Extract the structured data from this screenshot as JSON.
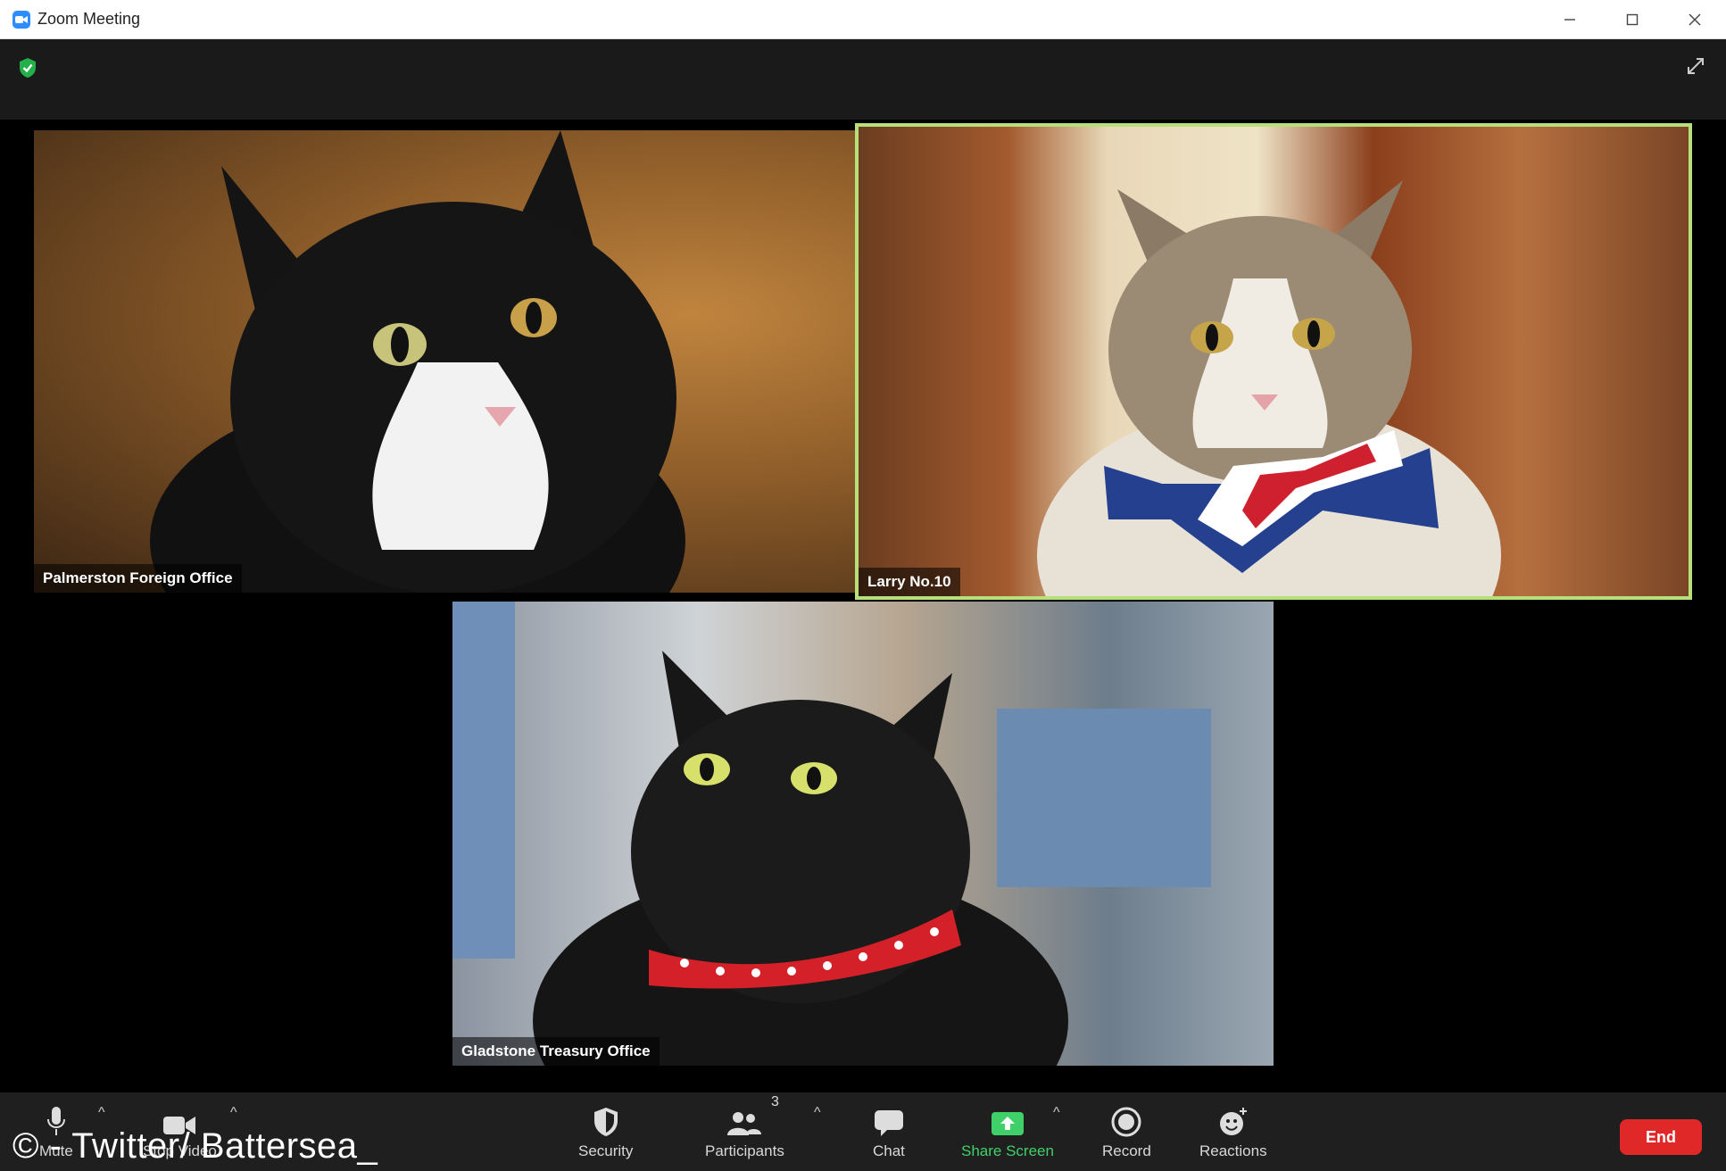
{
  "window": {
    "title": "Zoom Meeting",
    "icons": {
      "minimize": "minimize-icon",
      "maximize": "maximize-icon",
      "close": "close-icon"
    }
  },
  "topbar": {
    "security_icon": "shield-check-icon",
    "fullscreen_icon": "expand-icon"
  },
  "participants": [
    {
      "name": "Palmerston Foreign Office",
      "active_speaker": false
    },
    {
      "name": "Larry No.10",
      "active_speaker": true
    },
    {
      "name": "Gladstone Treasury Office",
      "active_speaker": false
    }
  ],
  "toolbar": {
    "mute": "Mute",
    "stop_video": "Stop Video",
    "security": "Security",
    "participants": "Participants",
    "participants_count": "3",
    "chat": "Chat",
    "share_screen": "Share Screen",
    "record": "Record",
    "reactions": "Reactions",
    "end": "End"
  },
  "watermark": "© - Twitter/ Battersea_",
  "colors": {
    "active_speaker_border": "#b8e07a",
    "share_green": "#3fd06a",
    "end_red": "#e02828",
    "zoom_blue": "#2d8cff"
  }
}
